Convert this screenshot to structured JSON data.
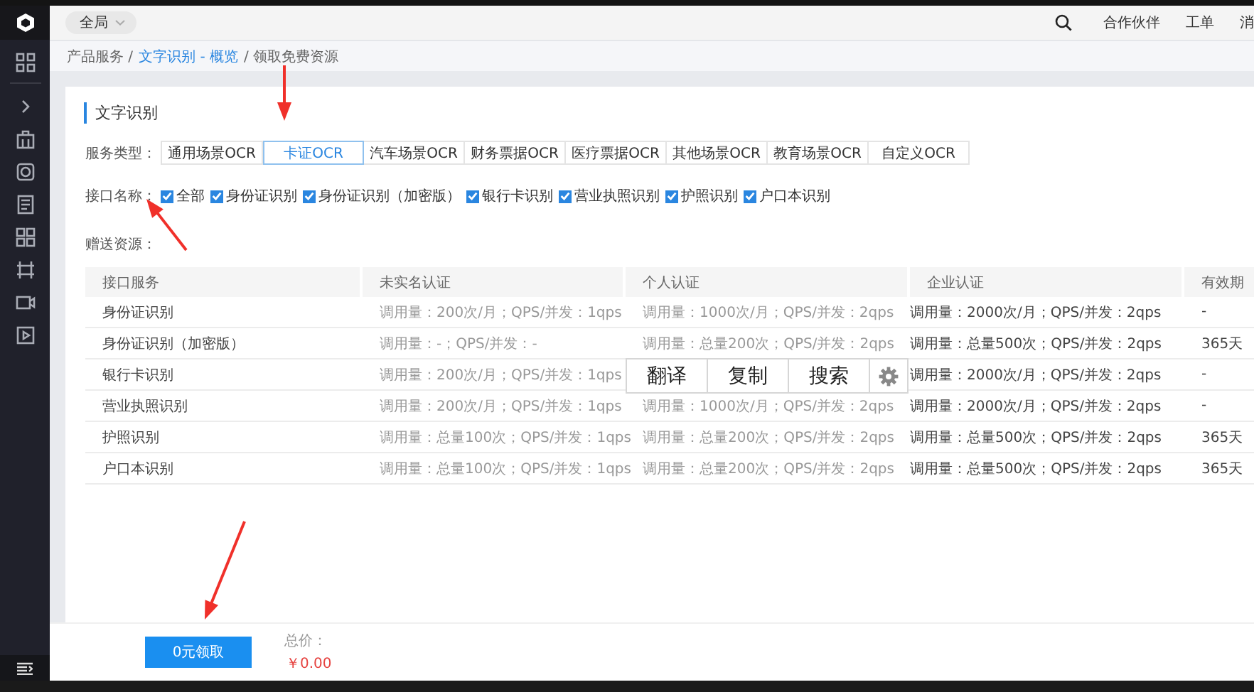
{
  "header": {
    "scope_selector": "全局",
    "links": [
      "合作伙伴",
      "工单",
      "消"
    ]
  },
  "breadcrumb": [
    {
      "label": "产品服务 /",
      "link": false
    },
    {
      "label": "文字识别 - 概览",
      "link": true
    },
    {
      "label": "/ 领取免费资源",
      "link": false
    }
  ],
  "card": {
    "title": "文字识别",
    "service_type": {
      "label": "服务类型：",
      "tabs": [
        {
          "label": "通用场景OCR",
          "selected": false
        },
        {
          "label": "卡证OCR",
          "selected": true
        },
        {
          "label": "汽车场景OCR",
          "selected": false
        },
        {
          "label": "财务票据OCR",
          "selected": false
        },
        {
          "label": "医疗票据OCR",
          "selected": false
        },
        {
          "label": "其他场景OCR",
          "selected": false
        },
        {
          "label": "教育场景OCR",
          "selected": false
        },
        {
          "label": "自定义OCR",
          "selected": false
        }
      ]
    },
    "interfaces": {
      "label": "接口名称：",
      "options": [
        {
          "label": "全部",
          "checked": true
        },
        {
          "label": "身份证识别",
          "checked": true
        },
        {
          "label": "身份证识别（加密版）",
          "checked": true
        },
        {
          "label": "银行卡识别",
          "checked": true
        },
        {
          "label": "营业执照识别",
          "checked": true
        },
        {
          "label": "护照识别",
          "checked": true
        },
        {
          "label": "户口本识别",
          "checked": true
        }
      ]
    },
    "gift_label": "赠送资源：",
    "table": {
      "columns": [
        "接口服务",
        "未实名认证",
        "个人认证",
        "企业认证",
        "有效期"
      ],
      "rows": [
        {
          "service": "身份证识别",
          "unverified": "调用量：200次/月；QPS/并发：1qps",
          "personal": "调用量：1000次/月；QPS/并发：2qps",
          "enterprise": "调用量：2000次/月；QPS/并发：2qps",
          "validity": "-"
        },
        {
          "service": "身份证识别（加密版）",
          "unverified": "调用量：-；QPS/并发：-",
          "personal": "调用量：总量200次；QPS/并发：2qps",
          "enterprise": "调用量：总量500次；QPS/并发：2qps",
          "validity": "365天"
        },
        {
          "service": "银行卡识别",
          "unverified": "调用量：200次/月；QPS/并发：1qps",
          "enterprise": "调用量：2000次/月；QPS/并发：2qps",
          "validity": "-"
        },
        {
          "service": "营业执照识别",
          "unverified": "调用量：200次/月；QPS/并发：1qps",
          "personal": "调用量：1000次/月；QPS/并发：2qps",
          "enterprise": "调用量：2000次/月；QPS/并发：2qps",
          "validity": "-"
        },
        {
          "service": "护照识别",
          "unverified": "调用量：总量100次；QPS/并发：1qps",
          "personal": "调用量：总量200次；QPS/并发：2qps",
          "enterprise": "调用量：总量500次；QPS/并发：2qps",
          "validity": "365天"
        },
        {
          "service": "户口本识别",
          "unverified": "调用量：总量100次；QPS/并发：1qps",
          "personal": "调用量：总量200次；QPS/并发：2qps",
          "enterprise": "调用量：总量500次；QPS/并发：2qps",
          "validity": "365天"
        }
      ]
    }
  },
  "context_popup": {
    "actions": [
      "翻译",
      "复制",
      "搜索"
    ]
  },
  "footer": {
    "button": "0元领取",
    "total_label": "总价：",
    "total": "￥0.00"
  }
}
